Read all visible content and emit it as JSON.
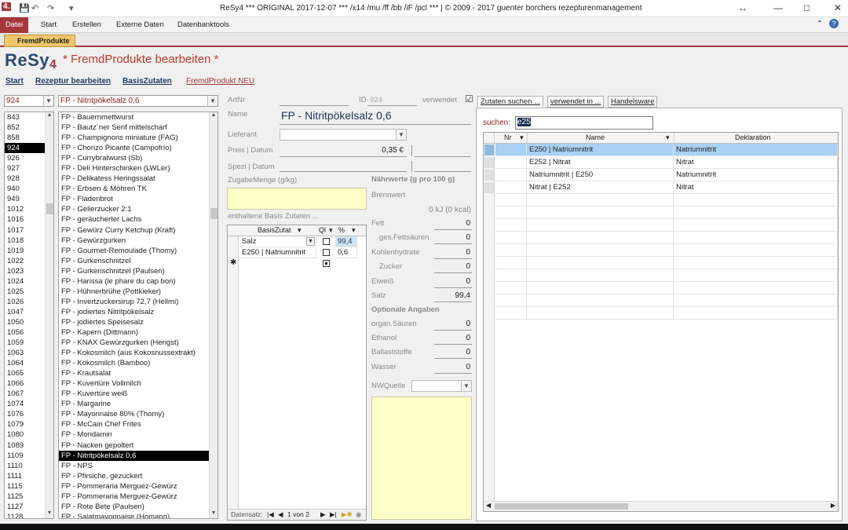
{
  "app": {
    "title": "ReSy4 *** ORIGINAL 2017-12-07 *** /x14 /mu /ff /bb /iF /pcl  *** | © 2009 - 2017 guenter borchers rezepturenmanagement",
    "icon_label": "4.",
    "ribbon_tabs": [
      "Datei",
      "Start",
      "Erstellen",
      "Externe Daten",
      "Datenbanktools"
    ],
    "doc_tab": "FremdProdukte",
    "logo_main": "ReSy",
    "logo_num": "4",
    "form_title": "* FremdProdukte bearbeiten *"
  },
  "nav": {
    "start": "Start",
    "rezeptur": "Rezeptur bearbeiten",
    "basis": "BasisZutaten",
    "neu": "FremdProdukt NEU"
  },
  "left": {
    "id_combo": "924",
    "name_combo": "FP - Nitritpökelsalz 0,6",
    "ids": [
      "843",
      "852",
      "858",
      "924",
      "926",
      "927",
      "928",
      "940",
      "949",
      "1012",
      "1016",
      "1017",
      "1018",
      "1019",
      "1022",
      "1023",
      "1024",
      "1025",
      "1026",
      "1047",
      "1050",
      "1056",
      "1059",
      "1063",
      "1064",
      "1065",
      "1066",
      "1067",
      "1074",
      "1076",
      "1079",
      "1080",
      "1089",
      "1109",
      "1110",
      "1111",
      "1115",
      "1125",
      "1127",
      "1128"
    ],
    "selected_id_index": 3,
    "names": [
      "FP - Bauernmettwurst",
      "FP - Bautz´ner Senf mittelscharf",
      "FP - Champignons miniature (FAG)",
      "FP - Chorizo Picante (Campofrío)",
      "FP - Currybratwurst (Sb)",
      "FP - Deli Hinterschinken (LWLer)",
      "FP - Delikatess Heringssalat",
      "FP - Erbsen & Möhren TK",
      "FP - Fladenbrot",
      "FP - Gelierzucker 2:1",
      "FP - geräucherter Lachs",
      "FP - Gewürz Curry Ketchup (Kraft)",
      "FP - Gewürzgurken",
      "FP - Gourmet-Remoulade (Thomy)",
      "FP - Gurkenschnitzel",
      "FP - Gurkenschnitzel (Paulsen)",
      "FP - Harissa (le phare du cap bon)",
      "FP - Hühnerbrühe (Pottkieker)",
      "FP - Invertzuckersirup 72,7 (Hellmi)",
      "FP - jodiertes Nitritpökelsalz",
      "FP - jodiertes Speisesalz",
      "FP - Kapern (Dittmann)",
      "FP - KNAX Gewürzgurken (Hengst)",
      "FP - Kokosmilch (aus Kokosnussextrakt)",
      "FP - Kokosmilch (Bamboo)",
      "FP - Krautsalat",
      "FP - Kuvertüre Vollmilch",
      "FP - Kuvertüre weiß",
      "FP - Margarine",
      "FP - Mayonnaise 80% (Thomy)",
      "FP - McCain Chef Frites",
      "FP - Mondamin",
      "FP - Nacken gepoltert",
      "FP - Nitritpökelsalz 0,6",
      "FP - NPS",
      "FP - Pfirsiche, gezuckert",
      "FP - Pommeraria Merguez-Gewürz",
      "FP - Pommeraria Merguez-Gewürz",
      "FP - Rote Bete (Paulsen)",
      "FP - Salatmayonnaise (Homann)"
    ],
    "selected_name_index": 33
  },
  "mid": {
    "artnr_label": "ArtNr",
    "id_label": "ID",
    "id_value": "924",
    "verwendet_label": "verwendet",
    "name_label": "Name",
    "name_value": "FP - Nitritpökelsalz 0,6",
    "lieferant_label": "Lieferant",
    "preis_label": "Preis | Datum",
    "preis_value": "0,35 €",
    "spezi_label": "Spezi | Datum",
    "zugabe_label": "ZugabeMenge (g/kg)",
    "enthaltene_label": "enthaltene Basis Zutaten ...",
    "grid_headers": [
      "BasisZutat",
      "Ql",
      "%"
    ],
    "grid_rows": [
      {
        "zutat": "Salz",
        "pct": "99,4"
      },
      {
        "zutat": "E250 | Natriumnitrit",
        "pct": "0,6"
      }
    ],
    "recnav_label": "Datensatz:",
    "recnav_pos": "1 von 2"
  },
  "nutr": {
    "title": "Nährwerte (g pro 100 g)",
    "brennwert_label": "Brennwert",
    "brennwert_value": "0 kJ (0 kcal)",
    "rows": [
      {
        "label": "Fett",
        "value": "0"
      },
      {
        "label": "ges.Fettsäuren",
        "value": "0"
      },
      {
        "label": "Kohlenhydrate",
        "value": "0"
      },
      {
        "label": "Zucker",
        "value": "0"
      },
      {
        "label": "Eiweiß",
        "value": "0"
      },
      {
        "label": "Salz",
        "value": "99,4"
      }
    ],
    "opt_title": "Optionale Angaben",
    "opt_rows": [
      {
        "label": "organ.Säuren",
        "value": "0"
      },
      {
        "label": "Ethanol",
        "value": "0"
      },
      {
        "label": "Ballaststoffe",
        "value": "0"
      },
      {
        "label": "Wasser",
        "value": "0"
      }
    ],
    "nwquelle_label": "NWQuelle"
  },
  "right": {
    "tabs": [
      "Zutaten suchen ...",
      "verwendet in ...",
      "Handelsware"
    ],
    "search_label": "suchen:",
    "search_value": "e25",
    "headers": [
      "Nr",
      "Name",
      "Deklaration"
    ],
    "rows": [
      {
        "name": "E250 | Natriumnitrit",
        "dekl": "Natriumnitrit"
      },
      {
        "name": "E252 | Nitrat",
        "dekl": "Nitrat"
      },
      {
        "name": "Natriumnitrit | E250",
        "dekl": "Natriumnitrit"
      },
      {
        "name": "Nitrat | E252",
        "dekl": "Nitrat"
      }
    ]
  },
  "colors": {
    "accent": "#a4373a",
    "selected_row": "#a9d0f5",
    "memo_yellow": "#ffffc8"
  }
}
